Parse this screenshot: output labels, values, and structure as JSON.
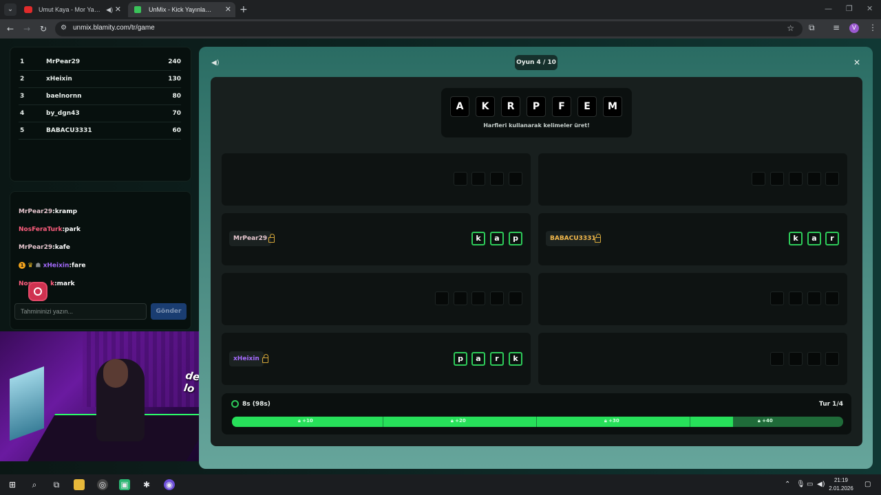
{
  "browser": {
    "tabs": [
      {
        "title": "Umut Kaya - Mor Yazma (O"
      },
      {
        "title": "UnMix - Kick Yayınları İçin Kelim"
      }
    ],
    "url": "unmix.blamity.com/tr/game",
    "profile_initial": "V"
  },
  "leaderboard": [
    {
      "rank": "1",
      "name": "MrPear29",
      "score": "240"
    },
    {
      "rank": "2",
      "name": "xHeixin",
      "score": "130"
    },
    {
      "rank": "3",
      "name": "baelnornn",
      "score": "80"
    },
    {
      "rank": "4",
      "name": "by_dgn43",
      "score": "70"
    },
    {
      "rank": "5",
      "name": "BABACU3331",
      "score": "60"
    }
  ],
  "chat": {
    "messages": [
      {
        "user": "MrPear29",
        "text": ":kramp",
        "color": "#e8c8d0"
      },
      {
        "user": "NosFeraTurk",
        "text": ":park",
        "color": "#ff5e7e"
      },
      {
        "user": "MrPear29",
        "text": ":kafe",
        "color": "#e8c8d0"
      },
      {
        "user": "xHeixin",
        "text": ":fare",
        "color": "#a66bff",
        "badge_num": "1"
      },
      {
        "user": "Nos",
        "suffix": "k",
        "text": ":mark",
        "color": "#ff5e7e"
      }
    ],
    "input_placeholder": "Tahmininizi yazın...",
    "send_label": "Gönder"
  },
  "stream": {
    "caption": "devamke lo"
  },
  "game": {
    "round_label": "Oyun 4 / 10",
    "letters": [
      "A",
      "K",
      "R",
      "P",
      "F",
      "E",
      "M"
    ],
    "hint": "Harfleri kullanarak kelimeler üret!",
    "slots": [
      {
        "player": "",
        "tiles": [],
        "empty": 4
      },
      {
        "player": "",
        "tiles": [],
        "empty": 5
      },
      {
        "player": "MrPear29",
        "player_color": "#e8c8d0",
        "tiles": [
          "k",
          "a",
          "p"
        ],
        "empty": 0
      },
      {
        "player": "BABACU3331",
        "player_color": "#f2b84b",
        "tiles": [
          "k",
          "a",
          "r"
        ],
        "empty": 0
      },
      {
        "player": "",
        "tiles": [],
        "empty": 5
      },
      {
        "player": "",
        "tiles": [],
        "empty": 4
      },
      {
        "player": "xHeixin",
        "player_color": "#a66bff",
        "tiles": [
          "p",
          "a",
          "r",
          "k"
        ],
        "empty": 0
      },
      {
        "player": "",
        "tiles": [],
        "empty": 4
      }
    ],
    "timer": "8s (98s)",
    "turn": "Tur 1/4",
    "progress_fraction": 0.82,
    "reward_markers": [
      "+10",
      "+20",
      "+30",
      "+40"
    ]
  },
  "taskbar": {
    "time": "21:19",
    "date": "2.01.2026"
  },
  "colors": {
    "accent_green": "#27e05a",
    "send_button": "#1a3d71"
  }
}
